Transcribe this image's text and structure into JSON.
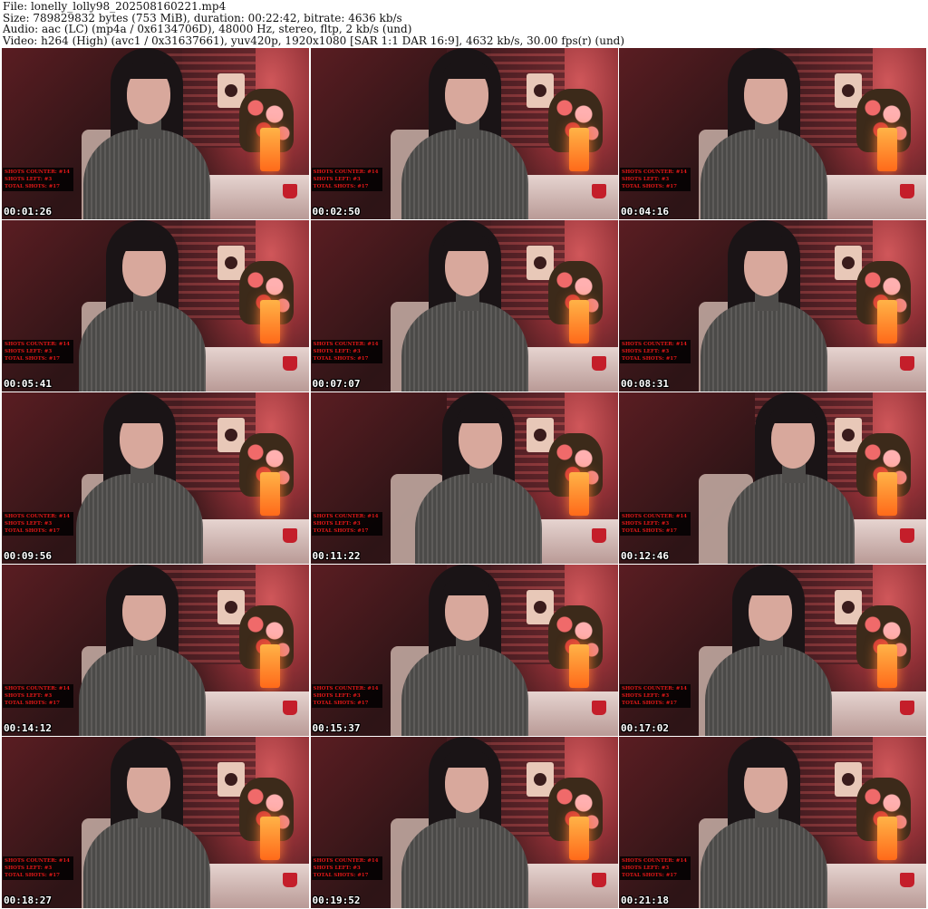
{
  "header": {
    "file": "File: lonelly_lolly98_202508160221.mp4",
    "size": "Size: 789829832 bytes (753 MiB), duration: 00:22:42, bitrate: 4636 kb/s",
    "audio": "Audio: aac (LC) (mp4a / 0x6134706D), 48000 Hz, stereo, fltp, 2 kb/s (und)",
    "video": "Video: h264 (High) (avc1 / 0x31637661), yuv420p, 1920x1080 [SAR 1:1 DAR 16:9], 4632 kb/s, 30.00 fps(r) (und)"
  },
  "overlay": {
    "line1": "SHOTS COUNTER: #14",
    "line2": "SHOTS LEFT: #3",
    "line3": "TOTAL SHOTS: #17"
  },
  "thumbnails": [
    {
      "timestamp": "00:01:26"
    },
    {
      "timestamp": "00:02:50"
    },
    {
      "timestamp": "00:04:16"
    },
    {
      "timestamp": "00:05:41"
    },
    {
      "timestamp": "00:07:07"
    },
    {
      "timestamp": "00:08:31"
    },
    {
      "timestamp": "00:09:56"
    },
    {
      "timestamp": "00:11:22"
    },
    {
      "timestamp": "00:12:46"
    },
    {
      "timestamp": "00:14:12"
    },
    {
      "timestamp": "00:15:37"
    },
    {
      "timestamp": "00:17:02"
    },
    {
      "timestamp": "00:18:27"
    },
    {
      "timestamp": "00:19:52"
    },
    {
      "timestamp": "00:21:18"
    }
  ]
}
